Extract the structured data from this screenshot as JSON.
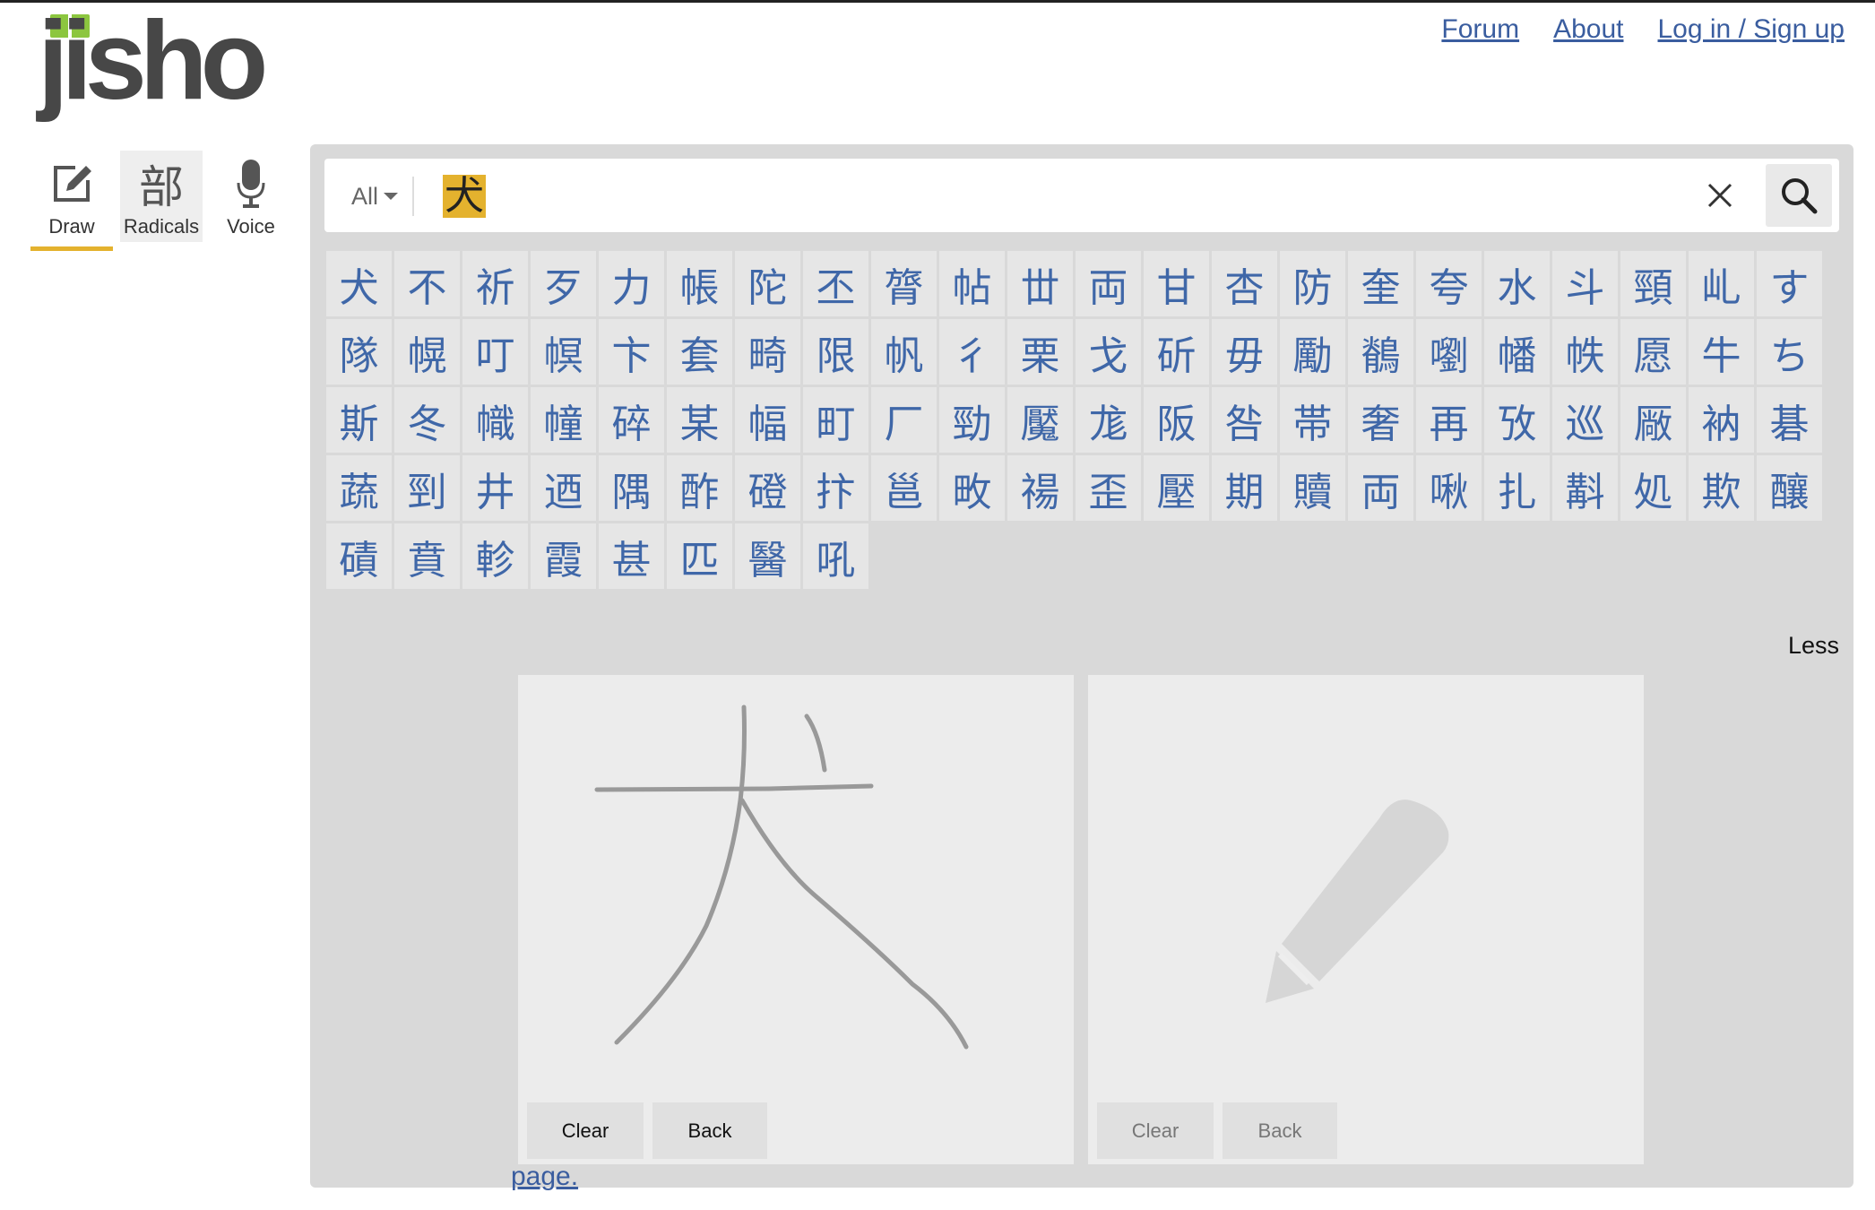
{
  "logo": {
    "text": "jisho"
  },
  "nav": {
    "forum": "Forum",
    "about": "About",
    "login": "Log in / Sign up"
  },
  "modes": {
    "draw": "Draw",
    "radicals": "Radicals",
    "radicals_glyph": "部",
    "voice": "Voice",
    "active": "draw"
  },
  "search": {
    "scope": "All",
    "query": "犬"
  },
  "kanji_candidates": [
    "犬",
    "不",
    "祈",
    "歹",
    "力",
    "帳",
    "陀",
    "丕",
    "膂",
    "帖",
    "丗",
    "両",
    "甘",
    "杏",
    "防",
    "奎",
    "夸",
    "水",
    "斗",
    "頸",
    "乢",
    "す",
    "隊",
    "幌",
    "叮",
    "幎",
    "卞",
    "套",
    "畸",
    "限",
    "帆",
    "彳",
    "栗",
    "戈",
    "斫",
    "毋",
    "勵",
    "鶺",
    "嚠",
    "幡",
    "帙",
    "愿",
    "牛",
    "ち",
    "斯",
    "冬",
    "幟",
    "幢",
    "碎",
    "某",
    "幅",
    "町",
    "厂",
    "勁",
    "魘",
    "尨",
    "阪",
    "咎",
    "帯",
    "奢",
    "再",
    "攷",
    "巡",
    "厰",
    "衲",
    "碁",
    "蔬",
    "剄",
    "井",
    "迺",
    "隅",
    "酢",
    "磴",
    "抃",
    "邕",
    "畋",
    "禓",
    "歪",
    "壓",
    "期",
    "贖",
    "両",
    "啾",
    "扎",
    "斠",
    "処",
    "欺",
    "釀",
    "磧",
    "賁",
    "軫",
    "霞",
    "甚",
    "匹",
    "醫",
    "吼"
  ],
  "less_label": "Less",
  "draw_panel": {
    "clear_label": "Clear",
    "back_label": "Back",
    "clear_label_2": "Clear",
    "back_label_2": "Back"
  },
  "footer_fragment": "page."
}
